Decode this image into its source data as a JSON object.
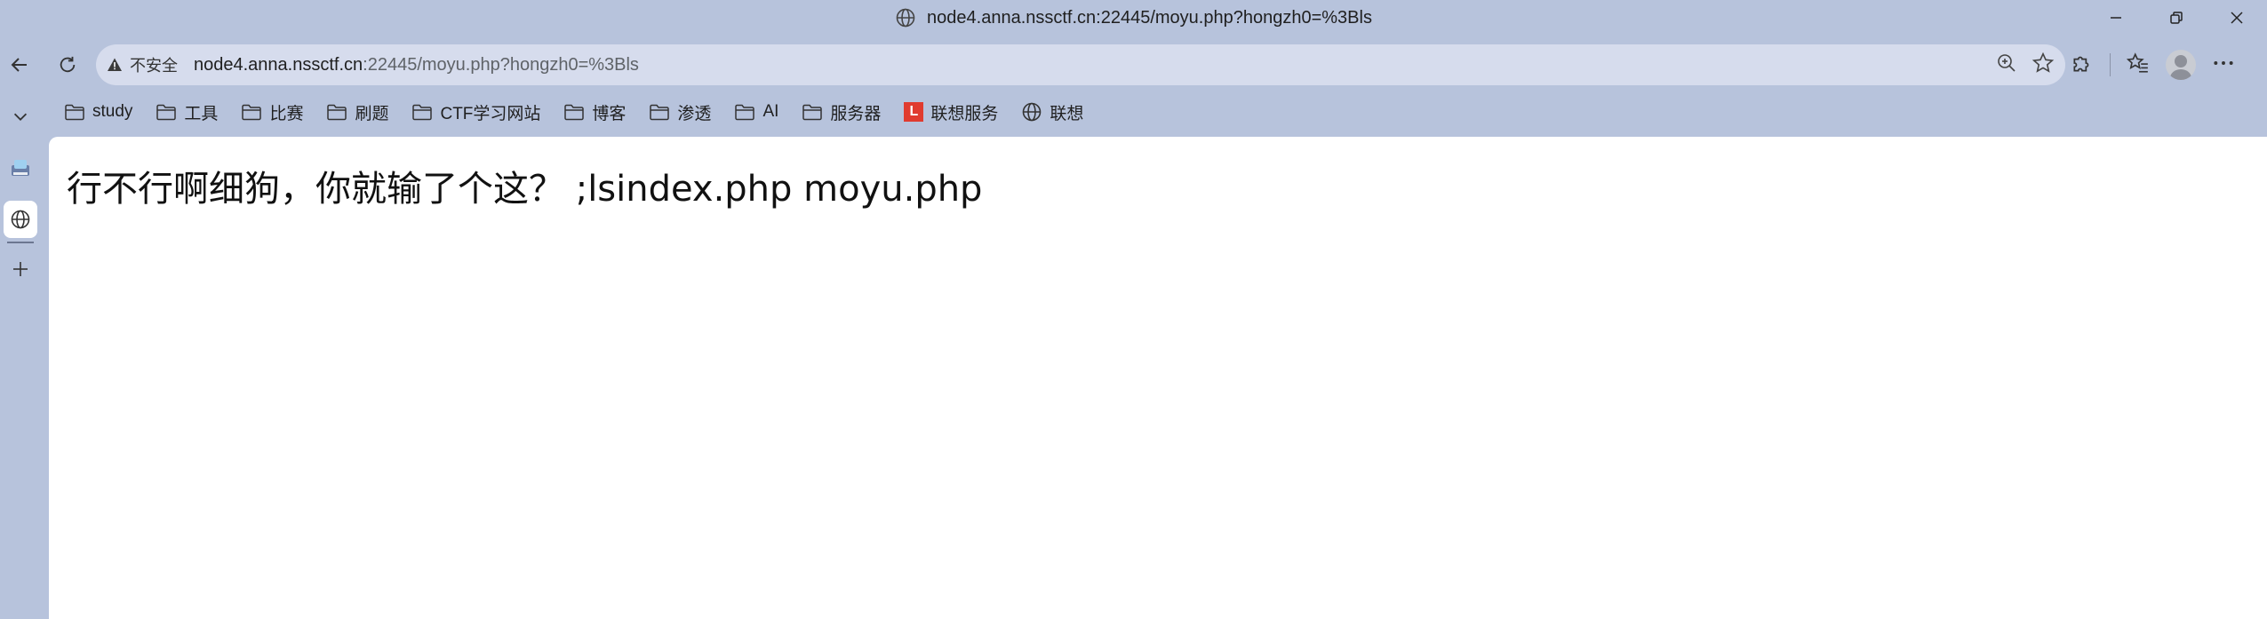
{
  "window": {
    "title": "node4.anna.nssctf.cn:22445/moyu.php?hongzh0=%3Bls",
    "controls": [
      "minimize-icon",
      "restore-icon",
      "close-icon"
    ]
  },
  "toolbar": {
    "security_label": "不安全",
    "url_host": "node4.anna.nssctf.cn",
    "url_rest": ":22445/moyu.php?hongzh0=%3Bls"
  },
  "bookmarks": [
    {
      "label": "study",
      "icon": "folder-icon"
    },
    {
      "label": "工具",
      "icon": "folder-icon"
    },
    {
      "label": "比赛",
      "icon": "folder-icon"
    },
    {
      "label": "刷题",
      "icon": "folder-icon"
    },
    {
      "label": "CTF学习网站",
      "icon": "folder-icon"
    },
    {
      "label": "博客",
      "icon": "folder-icon"
    },
    {
      "label": "渗透",
      "icon": "folder-icon"
    },
    {
      "label": "AI",
      "icon": "folder-icon"
    },
    {
      "label": "服务器",
      "icon": "folder-icon"
    },
    {
      "label": "联想服务",
      "icon": "lenovo-icon",
      "badge": "L"
    },
    {
      "label": "联想",
      "icon": "globe-icon"
    }
  ],
  "page": {
    "content": "行不行啊细狗，你就输了个这？ ;lsindex.php moyu.php"
  },
  "colors": {
    "frame": "#b7c3dc",
    "omnibox": "#d6dced",
    "page_bg": "#ffffff",
    "lenovo_red": "#e03b2f"
  }
}
